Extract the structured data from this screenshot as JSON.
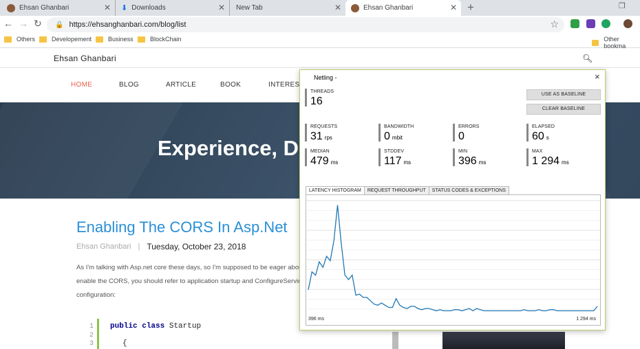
{
  "browser": {
    "tabs": [
      {
        "title": "Ehsan Ghanbari",
        "favicon": "bear-avatar-icon"
      },
      {
        "title": "Downloads",
        "favicon": "download-icon"
      },
      {
        "title": "New Tab",
        "favicon": ""
      },
      {
        "title": "Ehsan Ghanbari",
        "favicon": "bear-avatar-icon",
        "active": true
      }
    ],
    "new_tab": "+",
    "url": "https://ehsanghanbari.com/blog/list",
    "bookmarks": [
      "Others",
      "Developement",
      "Business",
      "BlockChain"
    ],
    "other_bookmarks": "Other bookma"
  },
  "site": {
    "title": "Ehsan Ghanbari",
    "menu": [
      "HOME",
      "BLOG",
      "ARTICLE",
      "BOOK",
      "INTEREST"
    ],
    "hero_text": "Experience, D",
    "post": {
      "title": "Enabling The CORS In Asp.Net",
      "author": "Ehsan Ghanbari",
      "separator": "|",
      "date": "Tuesday, October 23, 2018",
      "body": [
        "As I'm talking with Asp.net core these days, so I'm supposed to be eager abou",
        "enable the CORS, you should refer to application startup and ConfigureService",
        "configuration:"
      ],
      "code_line_numbers": [
        "1",
        "2",
        "3"
      ],
      "code_keyword_1": "public",
      "code_keyword_2": "class",
      "code_class": "Startup",
      "code_line_3": "{"
    }
  },
  "netling": {
    "title": "Netling -",
    "close": "×",
    "threads_label": "THREADS",
    "threads": "16",
    "use_baseline": "USE AS BASELINE",
    "clear_baseline": "CLEAR BASELINE",
    "stats": [
      {
        "label": "REQUESTS",
        "value": "31",
        "unit": "rps"
      },
      {
        "label": "BANDWIDTH",
        "value": "0",
        "unit": "mbit"
      },
      {
        "label": "ERRORS",
        "value": "0",
        "unit": ""
      },
      {
        "label": "ELAPSED",
        "value": "60",
        "unit": "s"
      },
      {
        "label": "MEDIAN",
        "value": "479",
        "unit": "ms"
      },
      {
        "label": "STDDEV",
        "value": "117",
        "unit": "ms"
      },
      {
        "label": "MIN",
        "value": "396",
        "unit": "ms"
      },
      {
        "label": "MAX",
        "value": "1 294",
        "unit": "ms"
      }
    ],
    "tabs": [
      "LATENCY HISTOGRAM",
      "REQUEST THROUGHPUT",
      "STATUS CODES & EXCEPTIONS"
    ],
    "x_min_label": "396 ms",
    "x_max_label": "1 294 ms",
    "line_color": "#1f77b4"
  },
  "chart_data": {
    "type": "line",
    "x_range": [
      396,
      1294
    ],
    "x_unit": "ms",
    "ylim": [
      0,
      1
    ],
    "grid": true,
    "values": [
      0.2,
      0.36,
      0.33,
      0.45,
      0.4,
      0.5,
      0.46,
      0.64,
      0.96,
      0.62,
      0.33,
      0.29,
      0.33,
      0.15,
      0.16,
      0.13,
      0.13,
      0.1,
      0.07,
      0.06,
      0.08,
      0.06,
      0.04,
      0.04,
      0.12,
      0.06,
      0.04,
      0.03,
      0.05,
      0.05,
      0.03,
      0.02,
      0.03,
      0.03,
      0.02,
      0.01,
      0.02,
      0.01,
      0.01,
      0.01,
      0.02,
      0.02,
      0.01,
      0.02,
      0.03,
      0.01,
      0.03,
      0.02,
      0.01,
      0.01,
      0.01,
      0.01,
      0.01,
      0.01,
      0.01,
      0.01,
      0.01,
      0.01,
      0.01,
      0.02,
      0.01,
      0.01,
      0.01,
      0.02,
      0.01,
      0.01,
      0.02,
      0.02,
      0.01,
      0.01,
      0.01,
      0.01,
      0.01,
      0.01,
      0.01,
      0.01,
      0.01,
      0.01,
      0.01,
      0.05
    ]
  }
}
